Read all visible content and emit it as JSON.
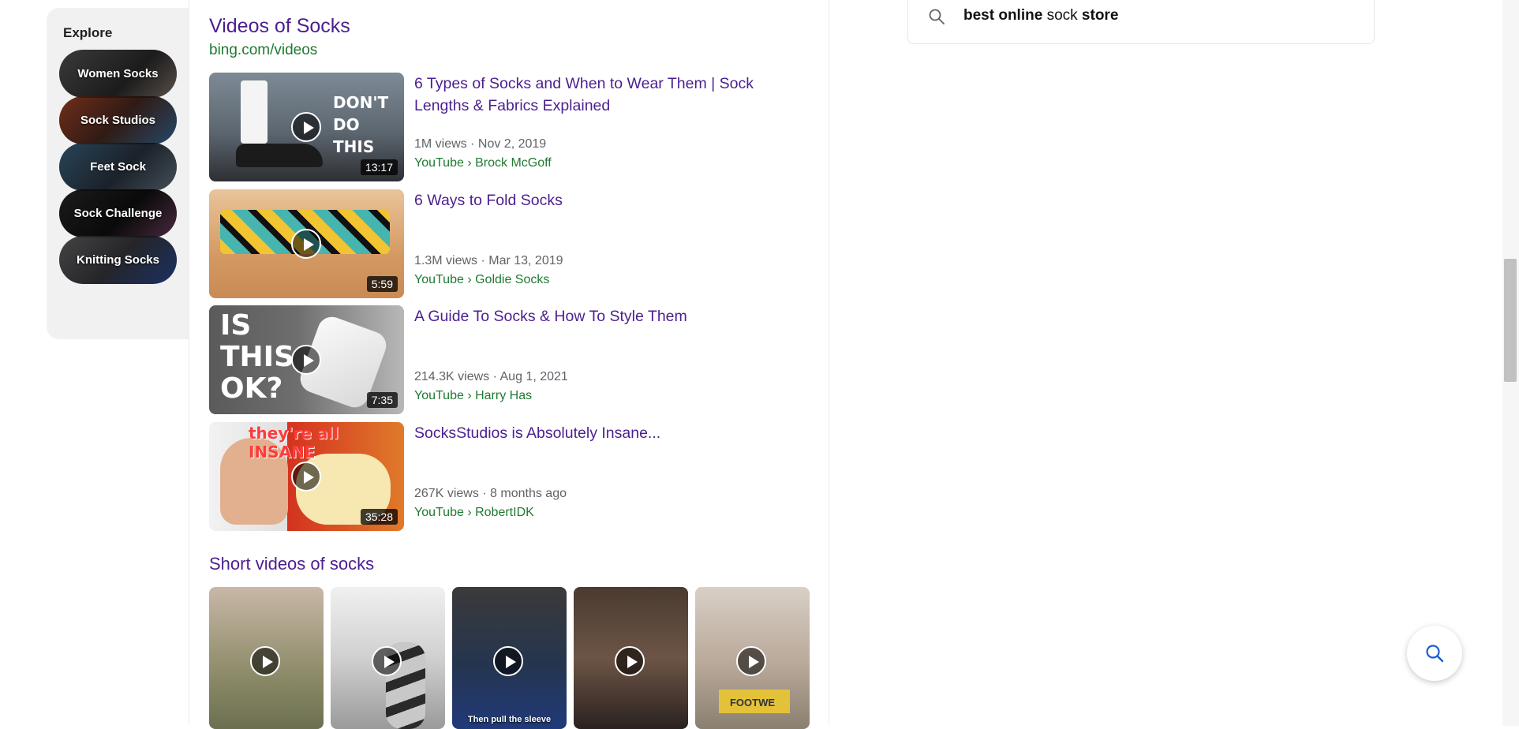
{
  "explore": {
    "title": "Explore",
    "items": [
      {
        "label": "Women Socks"
      },
      {
        "label": "Sock Studios"
      },
      {
        "label": "Feet Sock"
      },
      {
        "label": "Sock Challenge"
      },
      {
        "label": "Knitting Socks"
      }
    ]
  },
  "videos": {
    "title": "Videos of Socks",
    "source": "bing.com/videos",
    "items": [
      {
        "title": "6 Types of Socks and When to Wear Them | Sock Lengths & Fabrics Explained",
        "meta": "1M views · Nov 2, 2019",
        "source": "YouTube › Brock McGoff",
        "duration": "13:17",
        "thumb_text": "DON'T DO THIS"
      },
      {
        "title": "6 Ways to Fold Socks",
        "meta": "1.3M views · Mar 13, 2019",
        "source": "YouTube › Goldie Socks",
        "duration": "5:59"
      },
      {
        "title": "A Guide To Socks & How To Style Them",
        "meta": "214.3K views · Aug 1, 2021",
        "source": "YouTube › Harry Has",
        "duration": "7:35",
        "thumb_text": "IS THIS OK?"
      },
      {
        "title": "SocksStudios is Absolutely Insane...",
        "meta": "267K views · 8 months ago",
        "source": "YouTube › RobertIDK",
        "duration": "35:28",
        "thumb_text": "they're all INSANE"
      }
    ]
  },
  "shorts": {
    "title": "Short videos of socks",
    "items": [
      {
        "caption": ""
      },
      {
        "caption": ""
      },
      {
        "caption": "Then pull the sleeve"
      },
      {
        "caption": ""
      },
      {
        "caption": "FOOTWE"
      }
    ]
  },
  "search": {
    "query_bold_1": "best online",
    "query_plain": " sock ",
    "query_bold_2": "store"
  },
  "colors": {
    "link": "#4b1f8f",
    "source_green": "#1f7a32",
    "fab_icon": "#1a5fd0"
  }
}
